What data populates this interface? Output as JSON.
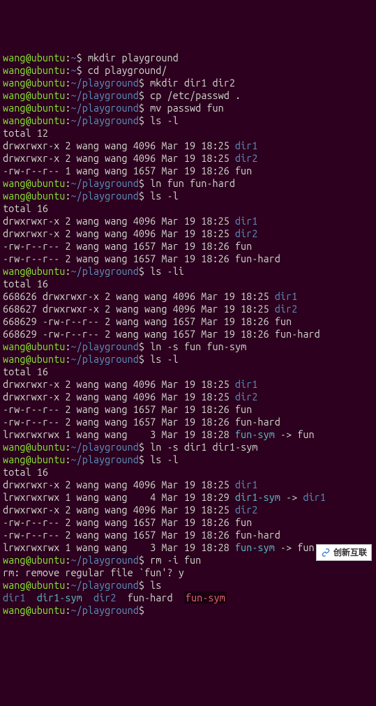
{
  "user": "wang",
  "host": "ubuntu",
  "home_path": "~",
  "play_path": "~/playground",
  "watermark": "创新互联",
  "lines": {
    "l1_cmd": "mkdir playground",
    "l2_cmd": "cd playground/",
    "l3_cmd": "mkdir dir1 dir2",
    "l4_cmd": "cp /etc/passwd .",
    "l5_cmd": "mv passwd fun",
    "l6_cmd": "ls -l",
    "total12": "total 12",
    "d1a": "drwxrwxr-x 2 wang wang 4096 Mar 19 18:25 ",
    "d2a": "drwxrwxr-x 2 wang wang 4096 Mar 19 18:25 ",
    "f1a": "-rw-r--r-- 1 wang wang 1657 Mar 19 18:26 fun",
    "l7_cmd": "ln fun fun-hard",
    "l8_cmd": "ls -l",
    "total16a": "total 16",
    "d1b": "drwxrwxr-x 2 wang wang 4096 Mar 19 18:25 ",
    "d2b": "drwxrwxr-x 2 wang wang 4096 Mar 19 18:25 ",
    "f1b": "-rw-r--r-- 2 wang wang 1657 Mar 19 18:26 fun",
    "f2b": "-rw-r--r-- 2 wang wang 1657 Mar 19 18:26 fun-hard",
    "l9_cmd": "ls -li",
    "total16b": "total 16",
    "li1": "668626 drwxrwxr-x 2 wang wang 4096 Mar 19 18:25 ",
    "li2": "668627 drwxrwxr-x 2 wang wang 4096 Mar 19 18:25 ",
    "li3": "668629 -rw-r--r-- 2 wang wang 1657 Mar 19 18:26 fun",
    "li4": "668629 -rw-r--r-- 2 wang wang 1657 Mar 19 18:26 fun-hard",
    "l10_cmd": "ln -s fun fun-sym",
    "l11_cmd": "ls -l",
    "total16c": "total 16",
    "d1c": "drwxrwxr-x 2 wang wang 4096 Mar 19 18:25 ",
    "d2c": "drwxrwxr-x 2 wang wang 4096 Mar 19 18:25 ",
    "f1c": "-rw-r--r-- 2 wang wang 1657 Mar 19 18:26 fun",
    "f2c": "-rw-r--r-- 2 wang wang 1657 Mar 19 18:26 fun-hard",
    "syml1_pre": "lrwxrwxrwx 1 wang wang    3 Mar 19 18:28 ",
    "syml1_name": "fun-sym",
    "syml1_arrow": " -> fun",
    "l12_cmd": "ln -s dir1 dir1-sym",
    "l13_cmd": "ls -l",
    "total16d": "total 16",
    "d1d": "drwxrwxr-x 2 wang wang 4096 Mar 19 18:25 ",
    "symd_pre": "lrwxrwxrwx 1 wang wang    4 Mar 19 18:29 ",
    "symd_name": "dir1-sym",
    "symd_arrow": " -> ",
    "symd_target": "dir1",
    "d2d": "drwxrwxr-x 2 wang wang 4096 Mar 19 18:25 ",
    "f1d": "-rw-r--r-- 2 wang wang 1657 Mar 19 18:26 fun",
    "f2d": "-rw-r--r-- 2 wang wang 1657 Mar 19 18:26 fun-hard",
    "syml2_pre": "lrwxrwxrwx 1 wang wang    3 Mar 19 18:28 ",
    "syml2_name": "fun-sym",
    "syml2_arrow": " -> fun",
    "l14_cmd": "rm -i fun",
    "rmq": "rm: remove regular file `fun'? y",
    "l15_cmd": "ls",
    "ls_dir1": "dir1",
    "ls_sp1": "  ",
    "ls_dir1sym": "dir1-sym",
    "ls_sp2": "  ",
    "ls_dir2": "dir2",
    "ls_sp3": "  fun-hard  ",
    "ls_funsym": "fun-sym",
    "dir1": "dir1",
    "dir2": "dir2"
  }
}
